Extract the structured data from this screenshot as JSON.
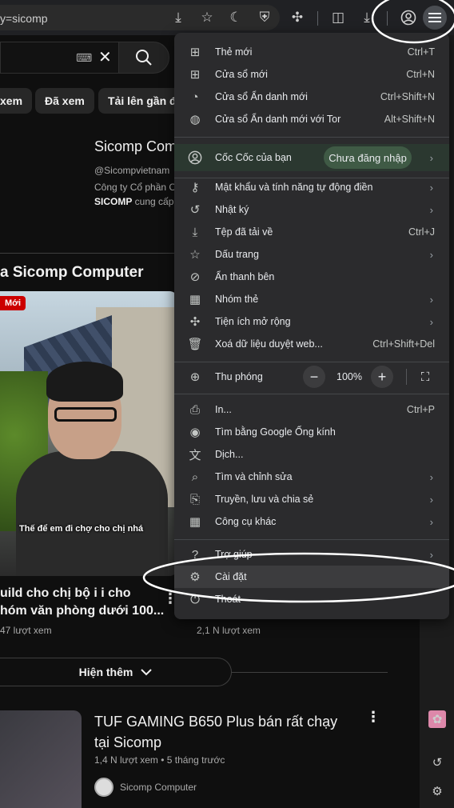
{
  "browser": {
    "address_text": "y=sicomp"
  },
  "youtube": {
    "chips": [
      "xem",
      "Đã xem",
      "Tải lên gần đây"
    ],
    "channel": {
      "name": "Sicomp Com",
      "handle": "@Sicompvietnam",
      "desc1": "Công ty Cổ phần C",
      "desc2_bold": "SICOMP",
      "desc2_rest": " cung cấp,"
    },
    "section_title": "a Sicomp Computer",
    "new_badge": "Mới",
    "caption": "Thế để em đi chợ cho chị nhá",
    "video1": {
      "title_line1": "uild cho chị bộ i i cho",
      "title_line2": "hóm văn phòng dưới 100...",
      "views": "47 lượt xem"
    },
    "video_b_views": "2,1 N lượt xem",
    "show_more": "Hiện thêm",
    "video2": {
      "title_line1": "TUF GAMING B650 Plus bán rất chạy",
      "title_line2": "tại Sicomp",
      "meta": "1,4 N lượt xem • 5 tháng trước",
      "channel": "Sicomp Computer"
    }
  },
  "menu": {
    "items_top": [
      {
        "label": "Thẻ mới",
        "shortcut": "Ctrl+T",
        "icon": "new-tab-icon"
      },
      {
        "label": "Cửa sổ mới",
        "shortcut": "Ctrl+N",
        "icon": "new-window-icon"
      },
      {
        "label": "Cửa sổ Ẩn danh mới",
        "shortcut": "Ctrl+Shift+N",
        "icon": "incognito-icon"
      },
      {
        "label": "Cửa sổ Ẩn danh mới với Tor",
        "shortcut": "Alt+Shift+N",
        "icon": "tor-icon"
      }
    ],
    "profile": {
      "label": "Cốc Cốc của bạn",
      "status": "Chưa đăng nhập"
    },
    "items_mid": [
      {
        "label": "Mật khẩu và tính năng tự động điền",
        "shortcut": "",
        "arrow": true
      },
      {
        "label": "Nhật ký",
        "shortcut": "",
        "arrow": true
      },
      {
        "label": "Tệp đã tải về",
        "shortcut": "Ctrl+J",
        "arrow": false
      },
      {
        "label": "Dấu trang",
        "shortcut": "",
        "arrow": true
      },
      {
        "label": "Ẩn thanh bên",
        "shortcut": "",
        "arrow": false
      },
      {
        "label": "Nhóm thẻ",
        "shortcut": "",
        "arrow": true
      },
      {
        "label": "Tiện ích mở rộng",
        "shortcut": "",
        "arrow": true
      },
      {
        "label": "Xoá dữ liệu duyệt web...",
        "shortcut": "Ctrl+Shift+Del",
        "arrow": false
      }
    ],
    "zoom": {
      "label": "Thu phóng",
      "value": "100%"
    },
    "items_bottom": [
      {
        "label": "In...",
        "shortcut": "Ctrl+P",
        "arrow": false
      },
      {
        "label": "Tìm bằng Google Ống kính",
        "shortcut": "",
        "arrow": false
      },
      {
        "label": "Dịch...",
        "shortcut": "",
        "arrow": false
      },
      {
        "label": "Tìm và chỉnh sửa",
        "shortcut": "",
        "arrow": true
      },
      {
        "label": "Truyền, lưu và chia sẻ",
        "shortcut": "",
        "arrow": true
      },
      {
        "label": "Công cụ khác",
        "shortcut": "",
        "arrow": true
      }
    ],
    "items_end": [
      {
        "label": "Trợ giúp",
        "arrow": true
      },
      {
        "label": "Cài đặt",
        "arrow": false
      },
      {
        "label": "Thoát",
        "arrow": false
      }
    ]
  },
  "colors": {
    "menu_bg": "#2b2b2d",
    "highlight": "#3c3c3e",
    "profile_pill": "#3f5a45",
    "annotation": "#ffffff"
  }
}
